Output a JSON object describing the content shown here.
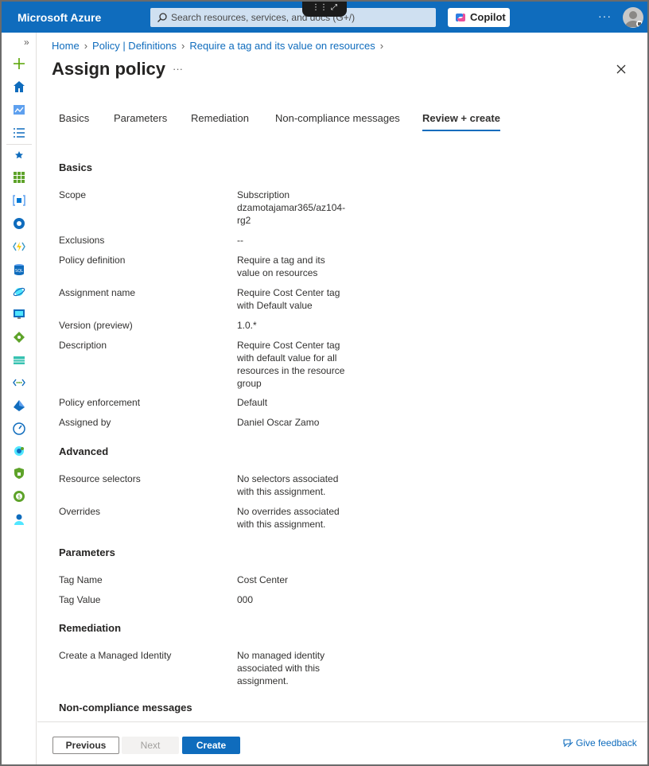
{
  "topbar": {
    "brand": "Microsoft Azure",
    "search_placeholder": "Search resources, services, and docs (G+/)",
    "copilot_label": "Copilot",
    "more": "···"
  },
  "breadcrumb": [
    "Home",
    "Policy | Definitions",
    "Require a tag and its value on resources"
  ],
  "page": {
    "title": "Assign policy",
    "title_more": "···"
  },
  "tabs": [
    "Basics",
    "Parameters",
    "Remediation",
    "Non-compliance messages",
    "Review + create"
  ],
  "active_tab": "Review + create",
  "review": {
    "basics": {
      "heading": "Basics",
      "scope_label": "Scope",
      "scope_value": "Subscription dzamotajamar365/az104-rg2",
      "exclusions_label": "Exclusions",
      "exclusions_value": "--",
      "policy_def_label": "Policy definition",
      "policy_def_value": "Require a tag and its value on resources",
      "assignment_name_label": "Assignment name",
      "assignment_name_value": "Require Cost Center tag with Default value",
      "version_label": "Version (preview)",
      "version_value": "1.0.*",
      "description_label": "Description",
      "description_value": "Require Cost Center tag with default value for all resources in the resource group",
      "enforcement_label": "Policy enforcement",
      "enforcement_value": "Default",
      "assigned_by_label": "Assigned by",
      "assigned_by_value": "Daniel Oscar Zamo"
    },
    "advanced": {
      "heading": "Advanced",
      "selectors_label": "Resource selectors",
      "selectors_value": "No selectors associated with this assignment.",
      "overrides_label": "Overrides",
      "overrides_value": "No overrides associated with this assignment."
    },
    "parameters": {
      "heading": "Parameters",
      "tag_name_label": "Tag Name",
      "tag_name_value": "Cost Center",
      "tag_value_label": "Tag Value",
      "tag_value_value": "000"
    },
    "remediation": {
      "heading": "Remediation",
      "identity_label": "Create a Managed Identity",
      "identity_value": "No managed identity associated with this assignment."
    },
    "next_heading_partial": "Non-compliance messages"
  },
  "footer": {
    "previous": "Previous",
    "next": "Next",
    "create": "Create",
    "feedback": "Give feedback"
  },
  "colors": {
    "accent": "#0f6cbd",
    "topbar": "#0f6cbd"
  }
}
